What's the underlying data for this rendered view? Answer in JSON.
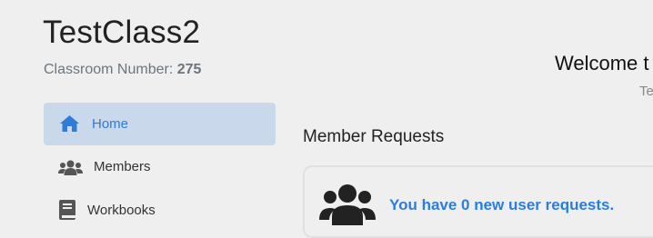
{
  "classroom": {
    "title": "TestClass2",
    "number_label": "Classroom Number:",
    "number_value": "275"
  },
  "nav": {
    "items": [
      {
        "label": "Home",
        "icon": "home-icon",
        "active": true
      },
      {
        "label": "Members",
        "icon": "users-icon",
        "active": false
      },
      {
        "label": "Workbooks",
        "icon": "book-icon",
        "active": false
      }
    ]
  },
  "welcome": {
    "title": "Welcome t",
    "subtitle": "Te"
  },
  "member_requests": {
    "title": "Member Requests",
    "message": "You have 0 new user requests."
  },
  "colors": {
    "accent": "#2f7bd6",
    "active_bg": "#c9d8ea",
    "background": "#efefef",
    "muted": "#6c757d"
  }
}
